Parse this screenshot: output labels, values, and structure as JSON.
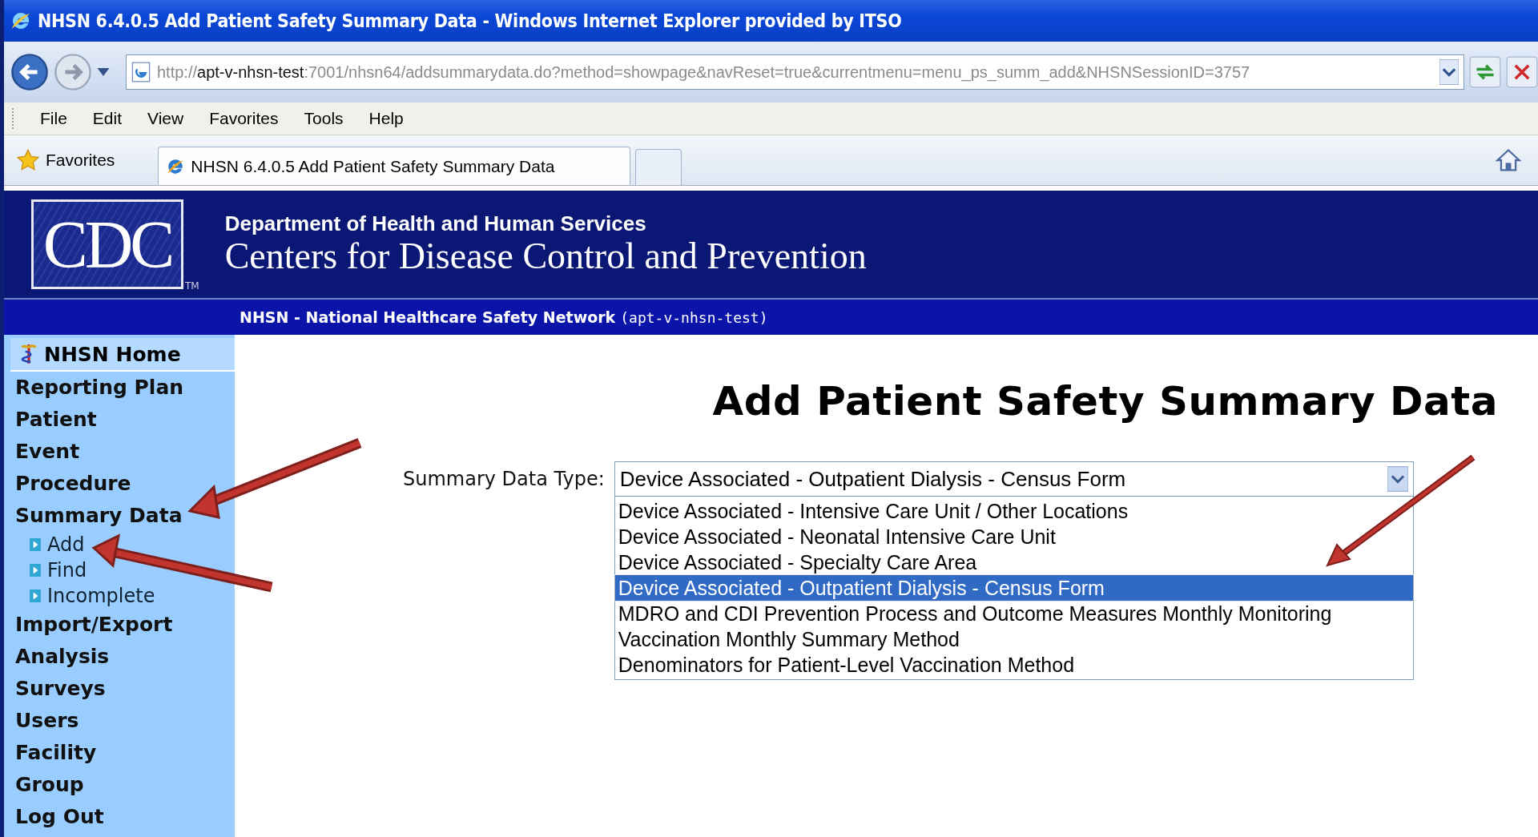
{
  "window": {
    "title": "NHSN 6.4.0.5 Add Patient Safety Summary Data - Windows Internet Explorer provided by ITSO"
  },
  "address_bar": {
    "segments": [
      {
        "text": "http://",
        "emphasis": false
      },
      {
        "text": "apt-v-nhsn-test",
        "emphasis": true
      },
      {
        "text": ":7001/nhsn64/addsummarydata.do?method=showpage&navReset=true&currentmenu=menu_ps_summ_add&NHSNSessionID=3757",
        "emphasis": false
      }
    ]
  },
  "menu": [
    "File",
    "Edit",
    "View",
    "Favorites",
    "Tools",
    "Help"
  ],
  "favorites_bar": {
    "label": "Favorites",
    "tabs": [
      {
        "title": "NHSN 6.4.0.5 Add Patient Safety Summary Data",
        "selected": true
      }
    ]
  },
  "header": {
    "logo": "CDC",
    "trademark": "TM",
    "department": "Department of Health and Human Services",
    "agency": "Centers for Disease Control and Prevention",
    "network": "NHSN - National Healthcare Safety Network",
    "server": "(apt-v-nhsn-test)"
  },
  "sidebar": {
    "items": [
      {
        "label": "NHSN Home",
        "kind": "home"
      },
      {
        "label": "Reporting Plan",
        "kind": "section"
      },
      {
        "label": "Patient",
        "kind": "section"
      },
      {
        "label": "Event",
        "kind": "section"
      },
      {
        "label": "Procedure",
        "kind": "section"
      },
      {
        "label": "Summary Data",
        "kind": "section",
        "children": [
          {
            "label": "Add"
          },
          {
            "label": "Find"
          },
          {
            "label": "Incomplete"
          }
        ]
      },
      {
        "label": "Import/Export",
        "kind": "section"
      },
      {
        "label": "Analysis",
        "kind": "section"
      },
      {
        "label": "Surveys",
        "kind": "section"
      },
      {
        "label": "Users",
        "kind": "section"
      },
      {
        "label": "Facility",
        "kind": "section"
      },
      {
        "label": "Group",
        "kind": "section"
      },
      {
        "label": "Log Out",
        "kind": "section"
      }
    ]
  },
  "page": {
    "title": "Add Patient Safety Summary Data",
    "field_label": "Summary Data Type:",
    "select_value": "Device Associated - Outpatient Dialysis - Census Form",
    "options": [
      {
        "label": "Device Associated - Intensive Care Unit / Other Locations",
        "selected": false
      },
      {
        "label": "Device Associated - Neonatal Intensive Care Unit",
        "selected": false
      },
      {
        "label": "Device Associated - Specialty Care Area",
        "selected": false
      },
      {
        "label": "Device Associated - Outpatient Dialysis - Census Form",
        "selected": true
      },
      {
        "label": "MDRO and CDI Prevention Process and Outcome Measures Monthly Monitoring",
        "selected": false
      },
      {
        "label": "Vaccination Monthly Summary Method",
        "selected": false
      },
      {
        "label": "Denominators for Patient-Level Vaccination Method",
        "selected": false
      }
    ]
  }
}
